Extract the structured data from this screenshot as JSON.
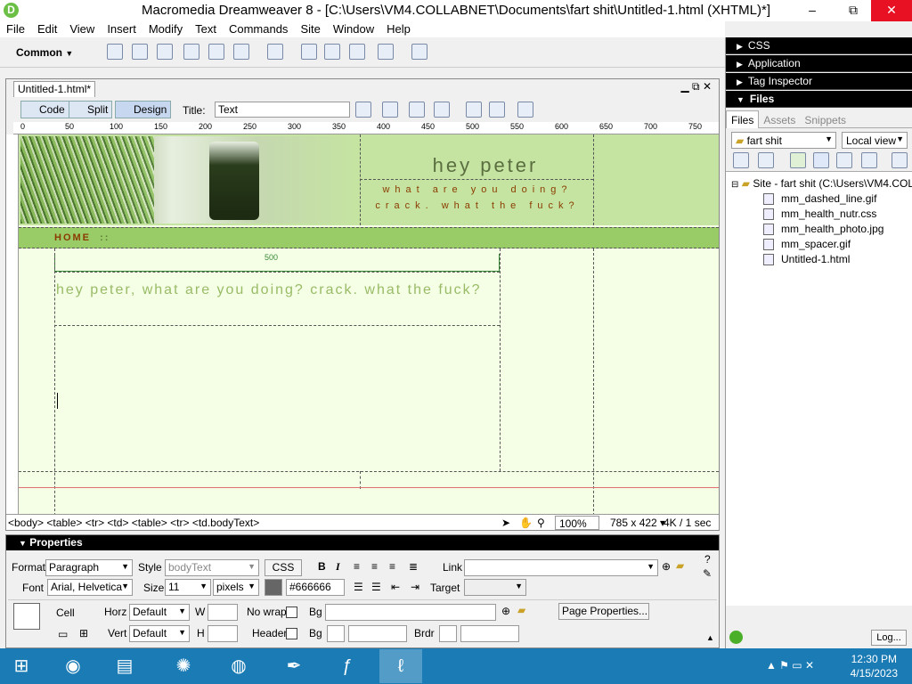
{
  "window": {
    "title": "Macromedia Dreamweaver 8 - [C:\\Users\\VM4.COLLABNET\\Documents\\fart shit\\Untitled-1.html (XHTML)*]",
    "minimize": "–",
    "maximize": "⧉",
    "close": "✕"
  },
  "menu": [
    "File",
    "Edit",
    "View",
    "Insert",
    "Modify",
    "Text",
    "Commands",
    "Site",
    "Window",
    "Help"
  ],
  "insert_bar": {
    "category": "Common"
  },
  "document": {
    "tab": "Untitled-1.html*",
    "views": {
      "code": "Code",
      "split": "Split",
      "design": "Design"
    },
    "title_label": "Title:",
    "title_value": "Text",
    "ruler_marks": [
      "0",
      "50",
      "100",
      "150",
      "200",
      "250",
      "300",
      "350",
      "400",
      "450",
      "500",
      "550",
      "600",
      "650",
      "700",
      "750"
    ],
    "page": {
      "heading": "hey peter",
      "sub1": "what are you doing?",
      "sub2": "crack. what the fuck?",
      "nav": "HOME",
      "nav_sep": "::",
      "table_width_label": "500",
      "body_text": "hey peter, what are you doing? crack. what the fuck?"
    },
    "tag_selector": "<body> <table> <tr> <td> <table> <tr> <td.bodyText>",
    "zoom": "100%",
    "window_size": "785 x 422",
    "download": "4K / 1 sec"
  },
  "properties": {
    "header": "Properties",
    "format_label": "Format",
    "format_value": "Paragraph",
    "style_label": "Style",
    "style_value": "bodyText",
    "css_button": "CSS",
    "link_label": "Link",
    "font_label": "Font",
    "font_value": "Arial, Helvetica",
    "size_label": "Size",
    "size_value": "11",
    "unit_value": "pixels",
    "color_value": "#666666",
    "target_label": "Target",
    "cell_label": "Cell",
    "horz_label": "Horz",
    "horz_value": "Default",
    "w_label": "W",
    "nowrap_label": "No wrap",
    "bg_label": "Bg",
    "page_props_button": "Page Properties...",
    "vert_label": "Vert",
    "vert_value": "Default",
    "h_label": "H",
    "header_label": "Header",
    "bg2_label": "Bg",
    "brdr_label": "Brdr"
  },
  "panels": {
    "css": "CSS",
    "application": "Application",
    "tag_inspector": "Tag Inspector",
    "files": "Files",
    "tabs": [
      "Files",
      "Assets",
      "Snippets"
    ],
    "site_select": "fart shit",
    "view_select": "Local view",
    "site_root": "Site - fart shit (C:\\Users\\VM4.COLLABN",
    "files_list": [
      "mm_dashed_line.gif",
      "mm_health_nutr.css",
      "mm_health_photo.jpg",
      "mm_spacer.gif",
      "Untitled-1.html"
    ],
    "log_button": "Log..."
  },
  "taskbar": {
    "time": "12:30 PM",
    "date": "4/15/2023"
  }
}
